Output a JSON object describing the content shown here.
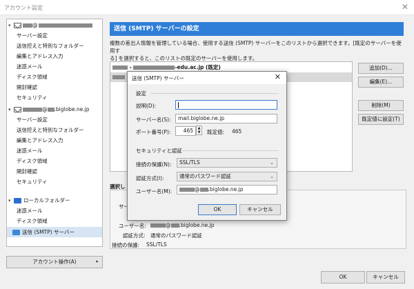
{
  "window": {
    "title": "アカウント設定",
    "close_glyph": "✕"
  },
  "tree": {
    "accounts": [
      {
        "name_suffix": "@",
        "items": [
          "サーバー設定",
          "送信控えと特別なフォルダー",
          "編集とアドレス入力",
          "迷惑メール",
          "ディスク領域",
          "開封確認",
          "セキュリティ"
        ]
      },
      {
        "name_suffix": "@",
        "name_domain": ".biglobe.ne.jp",
        "items": [
          "サーバー設定",
          "送信控えと特別なフォルダー",
          "編集とアドレス入力",
          "迷惑メール",
          "ディスク領域",
          "開封確認",
          "セキュリティ"
        ]
      }
    ],
    "local_folders": {
      "label": "ローカルフォルダー",
      "items": [
        "迷惑メール",
        "ディスク領域"
      ]
    },
    "smtp_item": "送信 (SMTP) サーバー",
    "account_actions": "アカウント操作(A)",
    "account_actions_arrow": "▾"
  },
  "panel": {
    "header": "送信 (SMTP) サーバーの設定",
    "description_line1": "複数の差出人情報を管理している場合、使用する送信 (SMTP) サーバーをこのリストから選択できます。[既定のサーバーを使用す",
    "description_line2": "る] を選択すると、このリストの既定のサーバーを使用します。",
    "servers": [
      {
        "prefix": " - ",
        "suffix": "-edu.ac.jp (既定)"
      }
    ],
    "buttons": {
      "add": "追加(D)...",
      "edit": "編集(E)...",
      "delete": "削除(M)",
      "set_default": "既定値に設定(T)"
    },
    "details_title": "選択し",
    "details": {
      "server_label_partial": "サー",
      "user_label": "ユーザー名:",
      "user_value_suffix": "@",
      "user_value_domain": ".biglobe.ne.jp",
      "auth_label": "認証方式:",
      "auth_value": "通常のパスワード認証",
      "security_label": "接続の保護:",
      "security_value": "SSL/TLS"
    },
    "ok": "OK",
    "cancel": "キャンセル"
  },
  "dialog": {
    "title": "送信 (SMTP) サーバー",
    "close_glyph": "✕",
    "settings_group": "設定",
    "description_label": "説明(D):",
    "description_value": "",
    "server_label": "サーバー名(S):",
    "server_value": "mail.biglobe.ne.jp",
    "port_label": "ポート番号(P):",
    "port_value": "465",
    "default_port_label": "既定値:",
    "default_port_value": "465",
    "security_group": "セキュリティと認証",
    "conn_security_label": "接続の保護(N):",
    "conn_security_value": "SSL/TLS",
    "auth_label": "認証方式(I):",
    "auth_value": "通常のパスワード認証",
    "user_label": "ユーザー名(M):",
    "user_value_suffix": "@",
    "user_value_domain": ".biglobe.ne.jp",
    "ok": "OK",
    "cancel": "キャンセル",
    "spin_up": "▲",
    "spin_down": "▼",
    "dropdown_glyph": "⌄"
  }
}
